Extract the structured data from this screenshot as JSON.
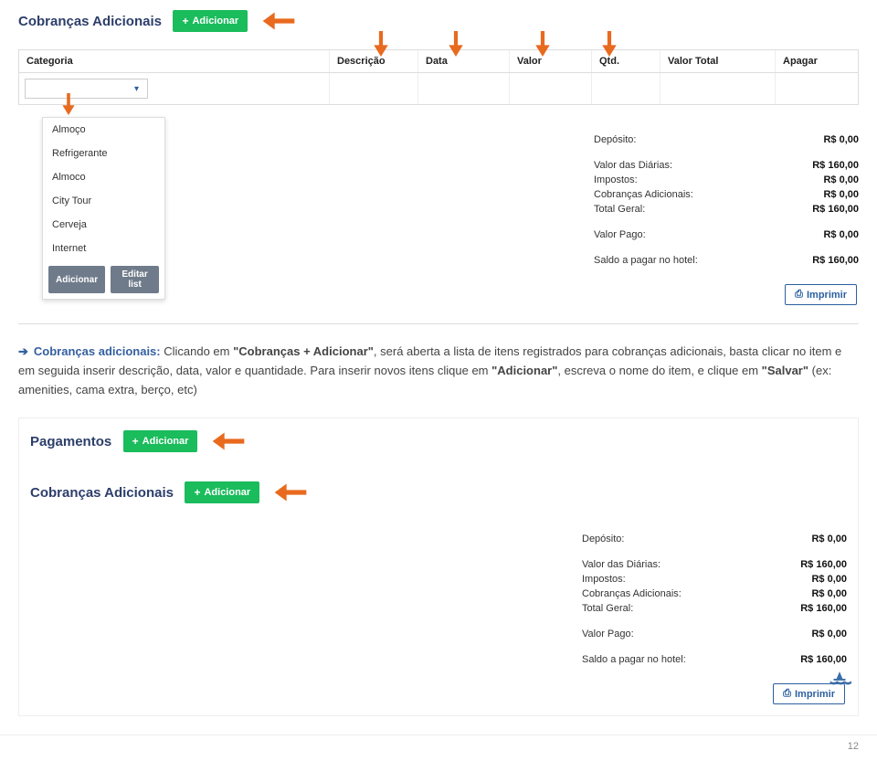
{
  "screenshot1": {
    "title": "Cobranças Adicionais",
    "addLabel": "Adicionar",
    "headers": {
      "categoria": "Categoria",
      "descricao": "Descrição",
      "data": "Data",
      "valor": "Valor",
      "qtd": "Qtd.",
      "valorTotal": "Valor Total",
      "apagar": "Apagar"
    },
    "dropdown": {
      "items": [
        "Almoço",
        "Refrigerante",
        "Almoco",
        "City Tour",
        "Cerveja",
        "Internet"
      ],
      "btnAdd": "Adicionar",
      "btnEdit": "Editar list"
    },
    "totals": {
      "deposito": {
        "label": "Depósito:",
        "value": "R$ 0,00"
      },
      "diarias": {
        "label": "Valor das Diárias:",
        "value": "R$ 160,00"
      },
      "impostos": {
        "label": "Impostos:",
        "value": "R$ 0,00"
      },
      "cobrancas": {
        "label": "Cobranças Adicionais:",
        "value": "R$ 0,00"
      },
      "totalGeral": {
        "label": "Total Geral:",
        "value": "R$ 160,00"
      },
      "valorPago": {
        "label": "Valor Pago:",
        "value": "R$ 0,00"
      },
      "saldo": {
        "label": "Saldo a pagar no hotel:",
        "value": "R$ 160,00"
      }
    },
    "printLabel": "Imprimir"
  },
  "instruction": {
    "lead": "Cobranças adicionais:",
    "body1": " Clicando em ",
    "kw1": "\"Cobranças + Adicionar\"",
    "body2": ", será aberta a lista de itens registrados para cobranças adicionais, basta clicar no item e em seguida inserir descrição, data, valor e quantidade. Para inserir novos itens clique em ",
    "kw2": "\"Adicionar\"",
    "body3": ", escreva o nome do item, e clique em ",
    "kw3": "\"Salvar\"",
    "body4": " (ex: amenities, cama extra, berço, etc)"
  },
  "screenshot2": {
    "pagamentos": {
      "title": "Pagamentos",
      "addLabel": "Adicionar"
    },
    "cobrancas": {
      "title": "Cobranças Adicionais",
      "addLabel": "Adicionar"
    },
    "totals": {
      "deposito": {
        "label": "Depósito:",
        "value": "R$ 0,00"
      },
      "diarias": {
        "label": "Valor das Diárias:",
        "value": "R$ 160,00"
      },
      "impostos": {
        "label": "Impostos:",
        "value": "R$ 0,00"
      },
      "cobrancas": {
        "label": "Cobranças Adicionais:",
        "value": "R$ 0,00"
      },
      "totalGeral": {
        "label": "Total Geral:",
        "value": "R$ 160,00"
      },
      "valorPago": {
        "label": "Valor Pago:",
        "value": "R$ 0,00"
      },
      "saldo": {
        "label": "Saldo a pagar no hotel:",
        "value": "R$ 160,00"
      }
    },
    "printLabel": "Imprimir"
  },
  "pageNumber": "12"
}
